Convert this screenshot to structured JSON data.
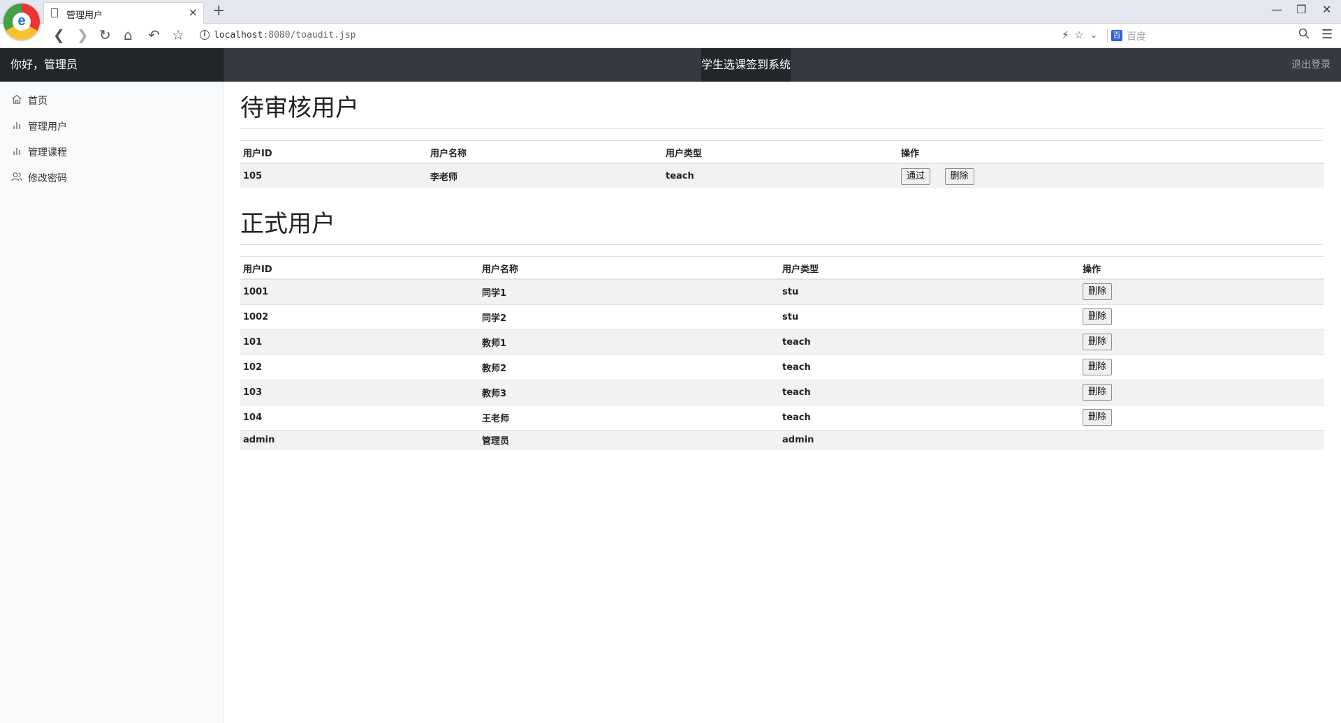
{
  "browser": {
    "tab_title": "管理用户",
    "tab_close": "×",
    "new_tab": "+",
    "url_host": "localhost",
    "url_path": ":8080/toaudit.jsp",
    "search_placeholder": "百度",
    "baidu_badge": "百",
    "window_controls": [
      "—",
      "❐",
      "✕"
    ]
  },
  "header": {
    "greeting": "你好，管理员",
    "system_title": "学生选课签到系统",
    "logout": "退出登录"
  },
  "sidebar": {
    "items": [
      {
        "label": "首页",
        "icon": "home-icon"
      },
      {
        "label": "管理用户",
        "icon": "bar-chart-icon"
      },
      {
        "label": "管理课程",
        "icon": "bar-chart-icon"
      },
      {
        "label": "修改密码",
        "icon": "users-icon"
      }
    ]
  },
  "pending": {
    "title": "待审核用户",
    "columns": [
      "用户ID",
      "用户名称",
      "用户类型",
      "操作"
    ],
    "rows": [
      {
        "id": "105",
        "name": "李老师",
        "type": "teach",
        "approve": "通过",
        "delete": "删除"
      }
    ]
  },
  "formal": {
    "title": "正式用户",
    "columns": [
      "用户ID",
      "用户名称",
      "用户类型",
      "操作"
    ],
    "rows": [
      {
        "id": "1001",
        "name": "同学1",
        "type": "stu",
        "delete": "删除"
      },
      {
        "id": "1002",
        "name": "同学2",
        "type": "stu",
        "delete": "删除"
      },
      {
        "id": "101",
        "name": "教师1",
        "type": "teach",
        "delete": "删除"
      },
      {
        "id": "102",
        "name": "教师2",
        "type": "teach",
        "delete": "删除"
      },
      {
        "id": "103",
        "name": "教师3",
        "type": "teach",
        "delete": "删除"
      },
      {
        "id": "104",
        "name": "王老师",
        "type": "teach",
        "delete": "删除"
      },
      {
        "id": "admin",
        "name": "管理员",
        "type": "admin"
      }
    ]
  }
}
